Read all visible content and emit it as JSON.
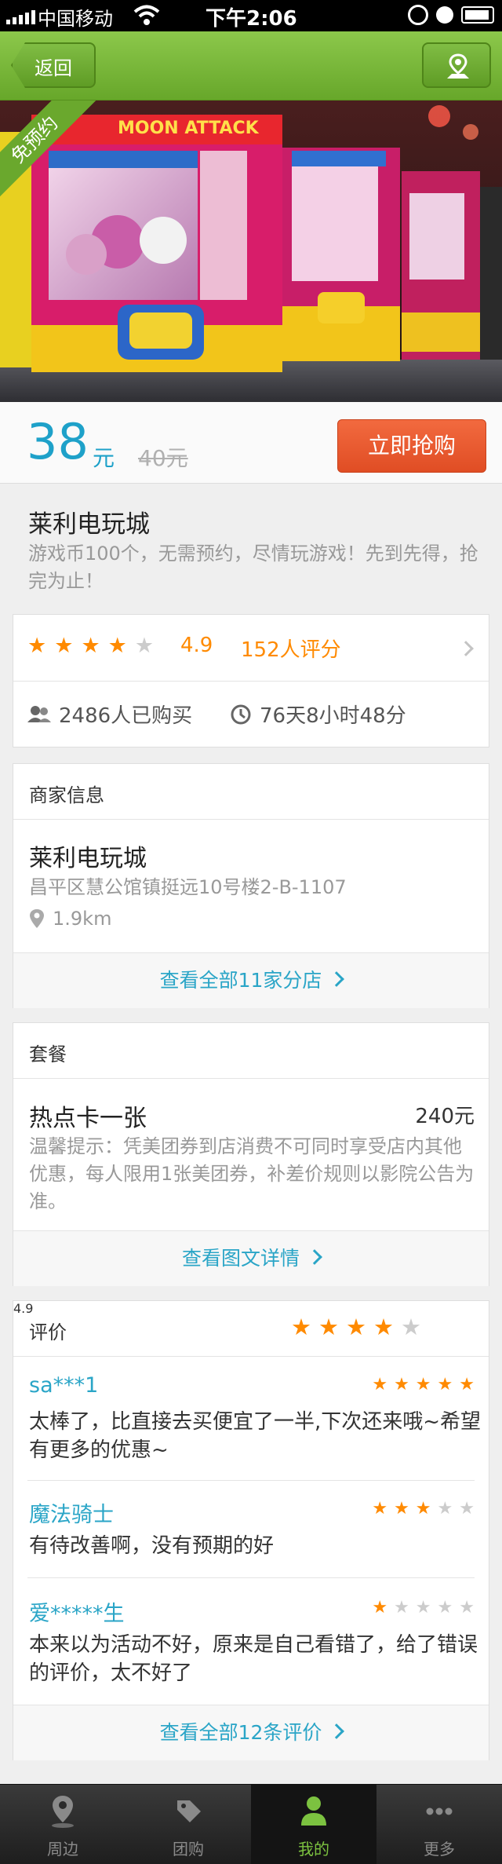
{
  "status_bar": {
    "carrier": "中国移动",
    "time": "下午2:06"
  },
  "nav": {
    "back_label": "返回",
    "map_icon": "map-pin-icon"
  },
  "hero": {
    "badge": "免预约",
    "sign_text": "MOON ATTACK"
  },
  "price": {
    "current": "38",
    "unit": "元",
    "original": "40元",
    "buy_label": "立即抢购"
  },
  "deal": {
    "title": "莱利电玩城",
    "description": "游戏币100个，无需预约，尽情玩游戏！先到先得，抢完为止！"
  },
  "rating": {
    "stars": 4,
    "score": "4.9",
    "count_label": "152人评分",
    "purchased": "2486人已购买",
    "time_left": "76天8小时48分"
  },
  "merchant": {
    "section_title": "商家信息",
    "name": "莱利电玩城",
    "address": "昌平区慧公馆镇挺远10号楼2-B-1107",
    "distance": "1.9km",
    "all_branches": "查看全部11家分店"
  },
  "package": {
    "section_title": "套餐",
    "name": "热点卡一张",
    "price": "240元",
    "tip": "温馨提示：凭美团券到店消费不可同时享受店内其他优惠，每人限用1张美团券，补差价规则以影院公告为准。",
    "details_link": "查看图文详情"
  },
  "reviews": {
    "section_title": "评价",
    "score": "4.9",
    "stars": 4,
    "items": [
      {
        "user": "sa***1",
        "stars": 5,
        "text": "太棒了，比直接去买便宜了一半,下次还来哦~希望有更多的优惠~"
      },
      {
        "user": "魔法骑士",
        "stars": 3,
        "text": "有待改善啊，没有预期的好"
      },
      {
        "user": "爱*****生",
        "stars": 1,
        "text": "本来以为活动不好，原来是自己看错了，给了错误的评价，太不好了"
      }
    ],
    "all_link": "查看全部12条评价"
  },
  "tabs": [
    {
      "label": "周边",
      "icon": "location-icon"
    },
    {
      "label": "团购",
      "icon": "tag-icon"
    },
    {
      "label": "我的",
      "icon": "user-icon"
    },
    {
      "label": "更多",
      "icon": "more-icon"
    }
  ],
  "colors": {
    "nav_green": "#7cbb3c",
    "price_blue": "#1ea1c9",
    "buy_orange": "#e95a2e",
    "star_orange": "#ff8a00",
    "link_blue": "#2aa5c7"
  }
}
